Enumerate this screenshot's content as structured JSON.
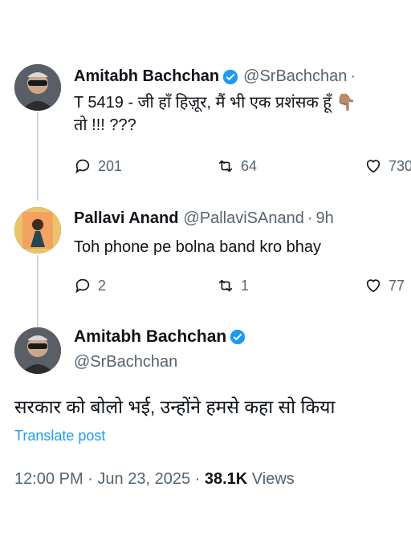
{
  "tweet1": {
    "name": "Amitabh Bachchan",
    "handle": "@SrBachchan",
    "sep": "·",
    "text_line1": "T 5419 - जी हाँ हिज़ूर, मैं भी एक प्रशंसक हूँ",
    "emoji": "👇🏽",
    "text_line2": "तो !!! ???",
    "replies": "201",
    "reposts": "64",
    "likes": "730"
  },
  "tweet2": {
    "name": "Pallavi Anand",
    "handle": "@PallaviSAnand",
    "sep": "·",
    "time": "9h",
    "text": "Toh phone pe bolna band kro bhay",
    "replies": "2",
    "reposts": "1",
    "likes": "77"
  },
  "main_tweet": {
    "name": "Amitabh Bachchan",
    "handle": "@SrBachchan",
    "text": "सरकार को बोलो भई, उन्होंने हमसे कहा सो किया",
    "translate_label": "Translate post",
    "time": "12:00 PM",
    "sep": "·",
    "date": "Jun 23, 2025",
    "views_count": "38.1K",
    "views_label": "Views"
  },
  "colors": {
    "accent": "#1d9bf0",
    "secondary_text": "#536471",
    "thread_line": "#cfd9de"
  }
}
